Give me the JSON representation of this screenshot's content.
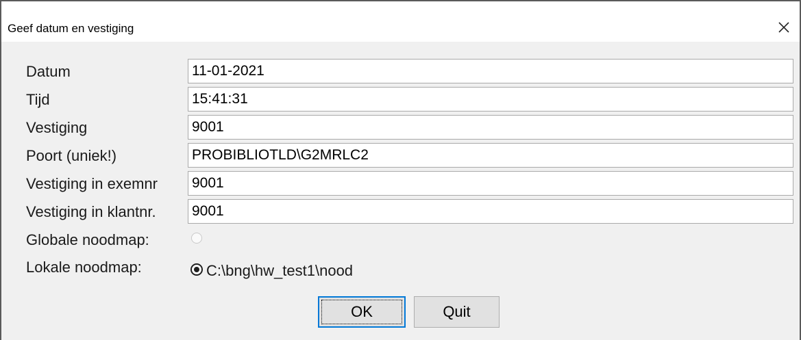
{
  "window": {
    "title": "Geef datum en vestiging"
  },
  "form": {
    "datum": {
      "label": "Datum",
      "value": "11-01-2021"
    },
    "tijd": {
      "label": "Tijd",
      "value": "15:41:31"
    },
    "vestiging": {
      "label": "Vestiging",
      "value": "9001"
    },
    "poort": {
      "label": "Poort (uniek!)",
      "value": "PROBIBLIOTLD\\G2MRLC2"
    },
    "vestiging_exemnr": {
      "label": "Vestiging in exemnr",
      "value": "9001"
    },
    "vestiging_klantnr": {
      "label": "Vestiging in klantnr.",
      "value": "9001"
    }
  },
  "noodmap": {
    "globale": {
      "label": "Globale noodmap:",
      "checked": false
    },
    "lokale": {
      "label": "Lokale noodmap:",
      "path": "C:\\bng\\hw_test1\\nood",
      "checked": true
    }
  },
  "buttons": {
    "ok": "OK",
    "quit": "Quit"
  },
  "colors": {
    "accent": "#0078d7",
    "dialog_bg": "#f0f0f0"
  }
}
